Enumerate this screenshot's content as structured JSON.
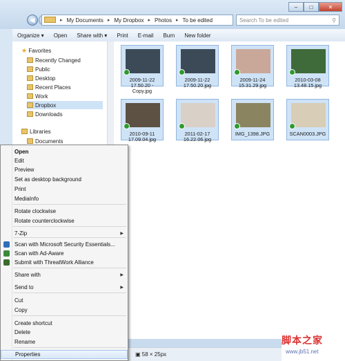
{
  "window": {
    "breadcrumb": [
      "My Documents",
      "My Dropbox",
      "Photos",
      "To be edited"
    ],
    "search_placeholder": "Search To be edited",
    "nav_back": "◀",
    "nav_forward": "▶",
    "win_min": "–",
    "win_max": "□",
    "win_close": "✕"
  },
  "toolbar": {
    "organize": "Organize ▾",
    "open": "Open",
    "share_with": "Share with ▾",
    "print": "Print",
    "email": "E-mail",
    "burn": "Burn",
    "new_folder": "New folder"
  },
  "nav": {
    "favorites": "Favorites",
    "items": [
      "Recently Changed",
      "Public",
      "Desktop",
      "Recent Places",
      "Work",
      "Dropbox",
      "Downloads"
    ],
    "libraries": "Libraries",
    "documents": "Documents"
  },
  "files": [
    {
      "name": "2009-11-22 17.50.20 - Copy.jpg",
      "line1": "2009-11-22",
      "line2": "17.50.20 -",
      "line3": "Copy.jpg",
      "color": "#3c4a58"
    },
    {
      "name": "2009-11-22 17.50.20.jpg",
      "line1": "2009-11-22",
      "line2": "17.50.20.jpg",
      "line3": "",
      "color": "#3c4a58"
    },
    {
      "name": "2009-11-24 15.31.29.jpg",
      "line1": "2009-11-24",
      "line2": "15.31.29.jpg",
      "line3": "",
      "color": "#c9a89a"
    },
    {
      "name": "2010-03-08 13.48.15.jpg",
      "line1": "2010-03-08",
      "line2": "13.48.15.jpg",
      "line3": "",
      "color": "#3f6a3a"
    },
    {
      "name": "2010-09-11 17.09.04.jpg",
      "line1": "2010-09-11",
      "line2": "17.09.04.jpg",
      "line3": "",
      "color": "#5c5142"
    },
    {
      "name": "2011-02-17 16.22.06.jpg",
      "line1": "2011-02-17",
      "line2": "16.22.06.jpg",
      "line3": "",
      "color": "#d9d0c8"
    },
    {
      "name": "IMG_1398.JPG",
      "line1": "IMG_1398.JPG",
      "line2": "",
      "line3": "",
      "color": "#8b8460"
    },
    {
      "name": "SCAN0003.JPG",
      "line1": "SCAN0003.JPG",
      "line2": "",
      "line3": "",
      "color": "#d8cdb6"
    }
  ],
  "context_menu": {
    "items": [
      {
        "label": "Open",
        "bold": true,
        "arrow": false,
        "icon": ""
      },
      {
        "label": "Edit",
        "bold": false,
        "arrow": false,
        "icon": ""
      },
      {
        "label": "Preview",
        "bold": false,
        "arrow": false,
        "icon": ""
      },
      {
        "label": "Set as desktop background",
        "bold": false,
        "arrow": false,
        "icon": ""
      },
      {
        "label": "Print",
        "bold": false,
        "arrow": false,
        "icon": ""
      },
      {
        "label": "MediaInfo",
        "bold": false,
        "arrow": false,
        "icon": ""
      },
      {
        "label": "Rotate clockwise",
        "bold": false,
        "arrow": false,
        "icon": ""
      },
      {
        "label": "Rotate counterclockwise",
        "bold": false,
        "arrow": false,
        "icon": ""
      },
      {
        "label": "7-Zip",
        "bold": false,
        "arrow": true,
        "icon": ""
      },
      {
        "label": "Scan with Microsoft Security Essentials...",
        "bold": false,
        "arrow": false,
        "icon": "#2f6fb8"
      },
      {
        "label": "Scan with Ad-Aware",
        "bold": false,
        "arrow": false,
        "icon": "#3a8a3a"
      },
      {
        "label": "Submit with ThreatWork Alliance",
        "bold": false,
        "arrow": false,
        "icon": "#3b6c2c"
      },
      {
        "label": "Share with",
        "bold": false,
        "arrow": true,
        "icon": ""
      },
      {
        "label": "Send to",
        "bold": false,
        "arrow": true,
        "icon": ""
      },
      {
        "label": "Cut",
        "bold": false,
        "arrow": false,
        "icon": ""
      },
      {
        "label": "Copy",
        "bold": false,
        "arrow": false,
        "icon": ""
      },
      {
        "label": "Create shortcut",
        "bold": false,
        "arrow": false,
        "icon": ""
      },
      {
        "label": "Delete",
        "bold": false,
        "arrow": false,
        "icon": ""
      },
      {
        "label": "Rename",
        "bold": false,
        "arrow": false,
        "icon": ""
      },
      {
        "label": "Properties",
        "bold": false,
        "arrow": false,
        "icon": ""
      }
    ]
  },
  "status": {
    "dimensions": "58 × 25px"
  },
  "watermark": {
    "cn": "脚本之家",
    "url": "www.jb51.net"
  }
}
